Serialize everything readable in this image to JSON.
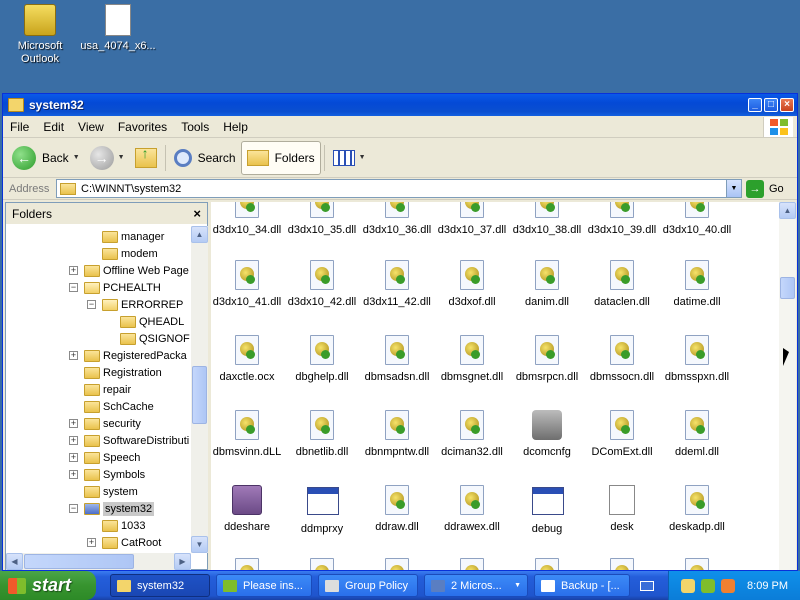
{
  "desktop": {
    "icons": [
      {
        "label": "Microsoft Outlook",
        "icon": "outlook-icon"
      },
      {
        "label": "usa_4074_x6...",
        "icon": "installer-icon"
      }
    ]
  },
  "window": {
    "title": "system32",
    "menu": [
      "File",
      "Edit",
      "View",
      "Favorites",
      "Tools",
      "Help"
    ],
    "toolbar": {
      "back": "Back",
      "search": "Search",
      "folders": "Folders"
    },
    "address": {
      "label": "Address",
      "value": "C:\\WINNT\\system32",
      "go": "Go"
    },
    "folders_pane": {
      "title": "Folders",
      "tree": [
        {
          "label": "manager",
          "indent": 1,
          "expander": ""
        },
        {
          "label": "modem",
          "indent": 1,
          "expander": ""
        },
        {
          "label": "Offline Web Page",
          "indent": 0,
          "expander": "+"
        },
        {
          "label": "PCHEALTH",
          "indent": 0,
          "expander": "-"
        },
        {
          "label": "ERRORREP",
          "indent": 1,
          "expander": "-"
        },
        {
          "label": "QHEADL",
          "indent": 2,
          "expander": ""
        },
        {
          "label": "QSIGNOF",
          "indent": 2,
          "expander": ""
        },
        {
          "label": "RegisteredPacka",
          "indent": 0,
          "expander": "+"
        },
        {
          "label": "Registration",
          "indent": 0,
          "expander": ""
        },
        {
          "label": "repair",
          "indent": 0,
          "expander": ""
        },
        {
          "label": "SchCache",
          "indent": 0,
          "expander": ""
        },
        {
          "label": "security",
          "indent": 0,
          "expander": "+"
        },
        {
          "label": "SoftwareDistributi",
          "indent": 0,
          "expander": "+"
        },
        {
          "label": "Speech",
          "indent": 0,
          "expander": "+"
        },
        {
          "label": "Symbols",
          "indent": 0,
          "expander": "+"
        },
        {
          "label": "system",
          "indent": 0,
          "expander": ""
        },
        {
          "label": "system32",
          "indent": 0,
          "expander": "-",
          "selected": true
        },
        {
          "label": "1033",
          "indent": 1,
          "expander": ""
        },
        {
          "label": "CatRoot",
          "indent": 1,
          "expander": "+"
        }
      ]
    },
    "files": [
      [
        "d3dx10_34.dll",
        "d3dx10_35.dll",
        "d3dx10_36.dll",
        "d3dx10_37.dll",
        "d3dx10_38.dll",
        "d3dx10_39.dll",
        "d3dx10_40.dll"
      ],
      [
        "d3dx10_41.dll",
        "d3dx10_42.dll",
        "d3dx11_42.dll",
        "d3dxof.dll",
        "danim.dll",
        "dataclen.dll",
        "datime.dll"
      ],
      [
        "daxctle.ocx",
        "dbghelp.dll",
        "dbmsadsn.dll",
        "dbmsgnet.dll",
        "dbmsrpcn.dll",
        "dbmssocn.dll",
        "dbmsspxn.dll"
      ],
      [
        "dbmsvinn.dLL",
        "dbnetlib.dll",
        "dbnmpntw.dll",
        "dciman32.dll",
        "dcomcnfg",
        "DComExt.dll",
        "ddeml.dll"
      ],
      [
        "ddeshare",
        "ddmprxy",
        "ddraw.dll",
        "ddrawex.dll",
        "debug",
        "desk",
        "deskadp.dll"
      ]
    ]
  },
  "taskbar": {
    "start": "start",
    "tasks": [
      "system32",
      "Please ins...",
      "Group Policy",
      "2 Micros...",
      "Backup - [..."
    ],
    "clock": "8:09 PM"
  }
}
